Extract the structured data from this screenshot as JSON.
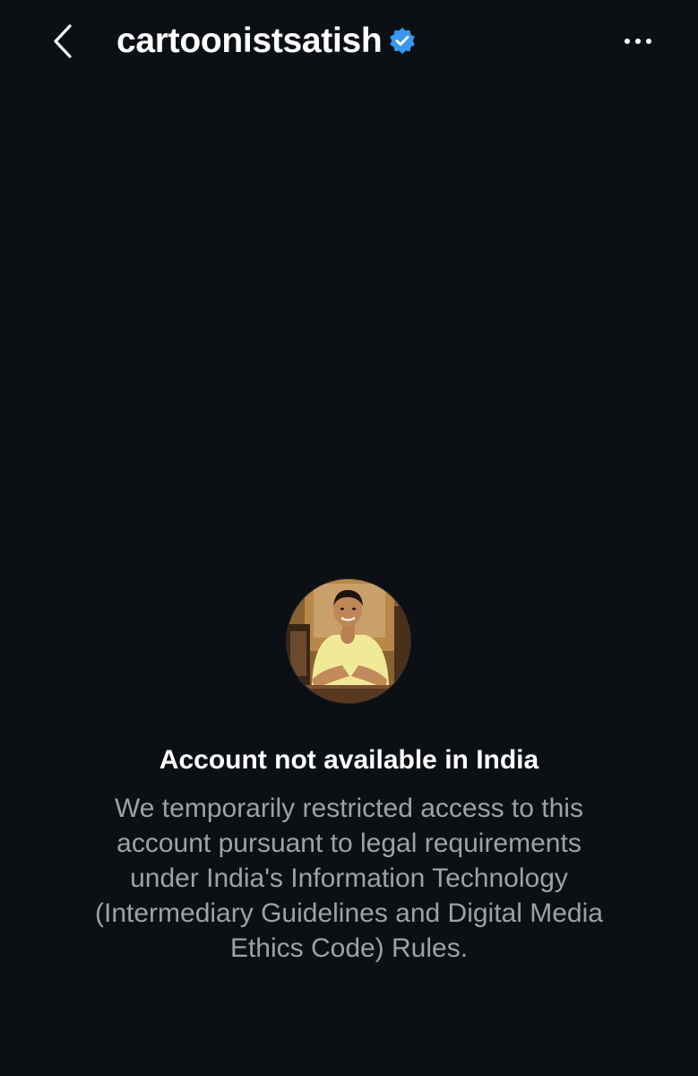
{
  "header": {
    "back_icon": "chevron-left-icon",
    "username": "cartoonistsatish",
    "verified_icon": "verified-badge-icon",
    "more_icon": "ellipsis-horizontal-icon"
  },
  "profile": {
    "avatar_icon": "profile-photo"
  },
  "notice": {
    "title": "Account not available in India",
    "lines": [
      "We temporarily restricted access to this",
      "account pursuant to legal requirements",
      "under India's Information Technology",
      "(Intermediary Guidelines and Digital Media",
      "Ethics Code) Rules."
    ]
  },
  "colors": {
    "background": "#0c1014",
    "text_primary": "#ffffff",
    "text_secondary": "#9ea1a6",
    "verified_blue": "#3897f0"
  }
}
